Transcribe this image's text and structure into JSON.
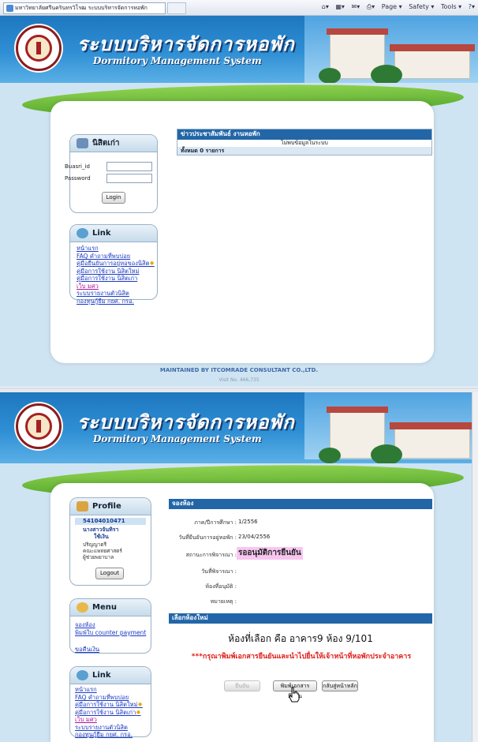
{
  "browser": {
    "tab_title": "มหาวิทยาลัยศรีนครินทรวิโรฒ ระบบบริหารจัดการหอพัก",
    "tools": [
      "Page ▾",
      "Safety ▾",
      "Tools ▾"
    ]
  },
  "header": {
    "title_th": "ระบบบริหารจัดการหอพัก",
    "title_en": "Dormitory Management System"
  },
  "login_page": {
    "login_panel": {
      "heading": "นิสิตเก่า",
      "user_label": "Buasri_id",
      "user_value": "",
      "pass_label": "Password",
      "pass_value": "",
      "login_button": "Login"
    },
    "link_panel": {
      "heading": "Link",
      "items": [
        "หน้าแรก",
        "FAQ คำถามที่พบบ่อย",
        "คู่มือยืนยันการอยู่หอของนิสิต",
        "คู่มือการใช้งาน นิสิตใหม่",
        "คู่มือการใช้งาน นิสิตเก่า",
        "เว็บ มศว",
        "ระบบรายงานตัวนิสิต",
        "กองทุนกู้ยืม กยศ. กรอ."
      ]
    },
    "news": {
      "heading": "ข่าวประชาสัมพันธ์ งานหอพัก",
      "empty": "ไม่พบข้อมูลในระบบ",
      "total": "ทั้งหมด 0 รายการ"
    },
    "footer": "MAINTAINED BY ITCOMRADE CONSULTANT CO.,LTD.",
    "visits": "Visit No. 466,735"
  },
  "dashboard": {
    "profile": {
      "heading": "Profile",
      "student_id": "54104010471",
      "name_line1": "นางสาวจันทิรา",
      "name_line2": "ใช้เงิน",
      "degree": "ปริญญาตรี",
      "faculty": "คณะแพทยศาสตร์",
      "major": "ผู้ช่วยพยาบาล",
      "logout": "Logout"
    },
    "menu": {
      "heading": "Menu",
      "items": [
        "จองห้อง",
        "พิมพ์ใบ counter payment",
        "ขอคืนเงิน"
      ]
    },
    "link_panel": {
      "heading": "Link",
      "items": [
        "หน้าแรก",
        "FAQ คำถามที่พบบ่อย",
        "คู่มือการใช้งาน นิสิตใหม่",
        "คู่มือการใช้งาน นิสิตเก่า",
        "เว็บ มศว",
        "ระบบรายงานตัวนิสิต",
        "กองทุนกู้ยืม กยศ. กรอ."
      ]
    },
    "booking": {
      "heading": "จองห้อง",
      "fields": [
        {
          "label": "ภาค/ปีการศึกษา :",
          "value": "1/2556"
        },
        {
          "label": "วันที่ยืนยันการอยู่หอพัก :",
          "value": "23/04/2556"
        },
        {
          "label": "สถานะการพิจารณา :",
          "value": "รออนุมัติการยืนยัน"
        },
        {
          "label": "วันที่พิจารณา :",
          "value": ""
        },
        {
          "label": "ห้องที่อนุมัติ :",
          "value": ""
        },
        {
          "label": "หมายเหตุ :",
          "value": ""
        }
      ]
    },
    "new_room": {
      "heading": "เลือกห้องใหม่",
      "selected": "ห้องที่เลือก คือ อาคาร9 ห้อง 9/101",
      "warning": "***กรุณาพิมพ์เอกสารยืนยันและนำไปยื่นให้เจ้าหน้าที่หอพักประจำอาคาร",
      "buttons": [
        "ยืนยัน",
        "พิมพ์เอกสารยืนยัน",
        "กลับสู่หน้าหลัก"
      ]
    }
  },
  "colors": {
    "header_blue": "#2f8fd4",
    "section_navy": "#2266a8",
    "link_blue": "#1a39c4",
    "status_pink": "#f8c6f0",
    "warning_red": "#e0201b"
  }
}
